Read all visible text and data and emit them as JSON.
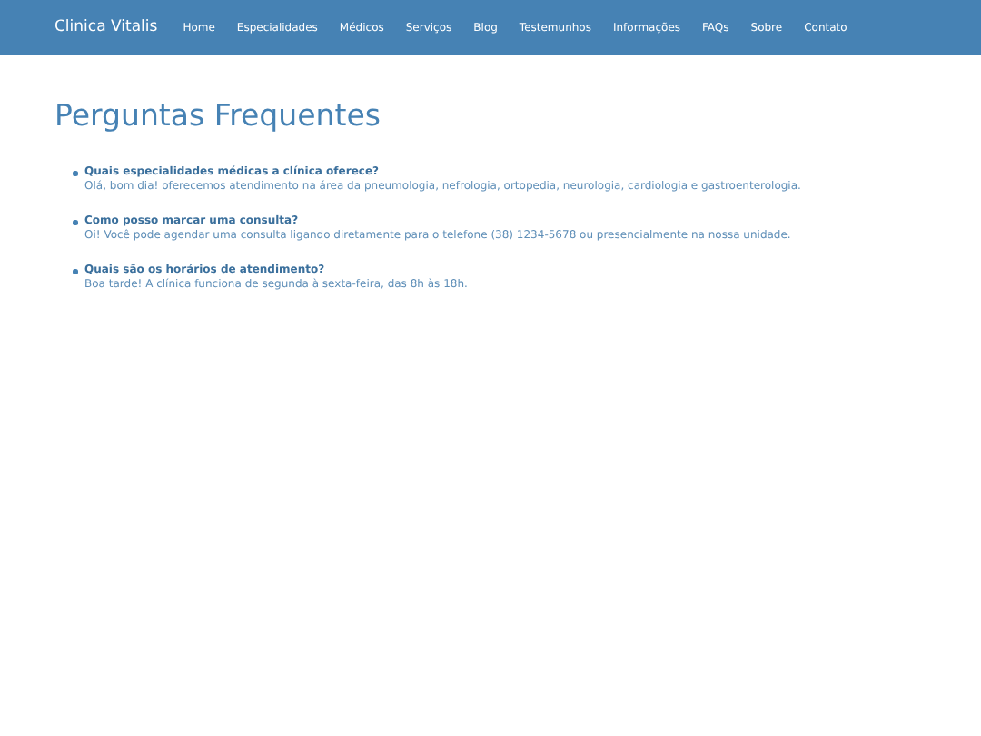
{
  "navbar": {
    "brand": "Clinica Vitalis",
    "links": [
      "Home",
      "Especialidades",
      "Médicos",
      "Serviços",
      "Blog",
      "Testemunhos",
      "Informações",
      "FAQs",
      "Sobre",
      "Contato"
    ]
  },
  "page_title": "Perguntas Frequentes",
  "faqs": [
    {
      "question": "Quais especialidades médicas a clínica oferece?",
      "answer": "Olá, bom dia! oferecemos atendimento na área da pneumologia, nefrologia, ortopedia, neurologia, cardiologia e gastroenterologia."
    },
    {
      "question": "Como posso marcar uma consulta?",
      "answer": "Oi! Você pode agendar uma consulta ligando diretamente para o telefone (38) 1234-5678 ou presencialmente na nossa unidade."
    },
    {
      "question": "Quais são os horários de atendimento?",
      "answer": "Boa tarde! A clínica funciona de segunda à sexta-feira, das 8h às 18h."
    }
  ]
}
